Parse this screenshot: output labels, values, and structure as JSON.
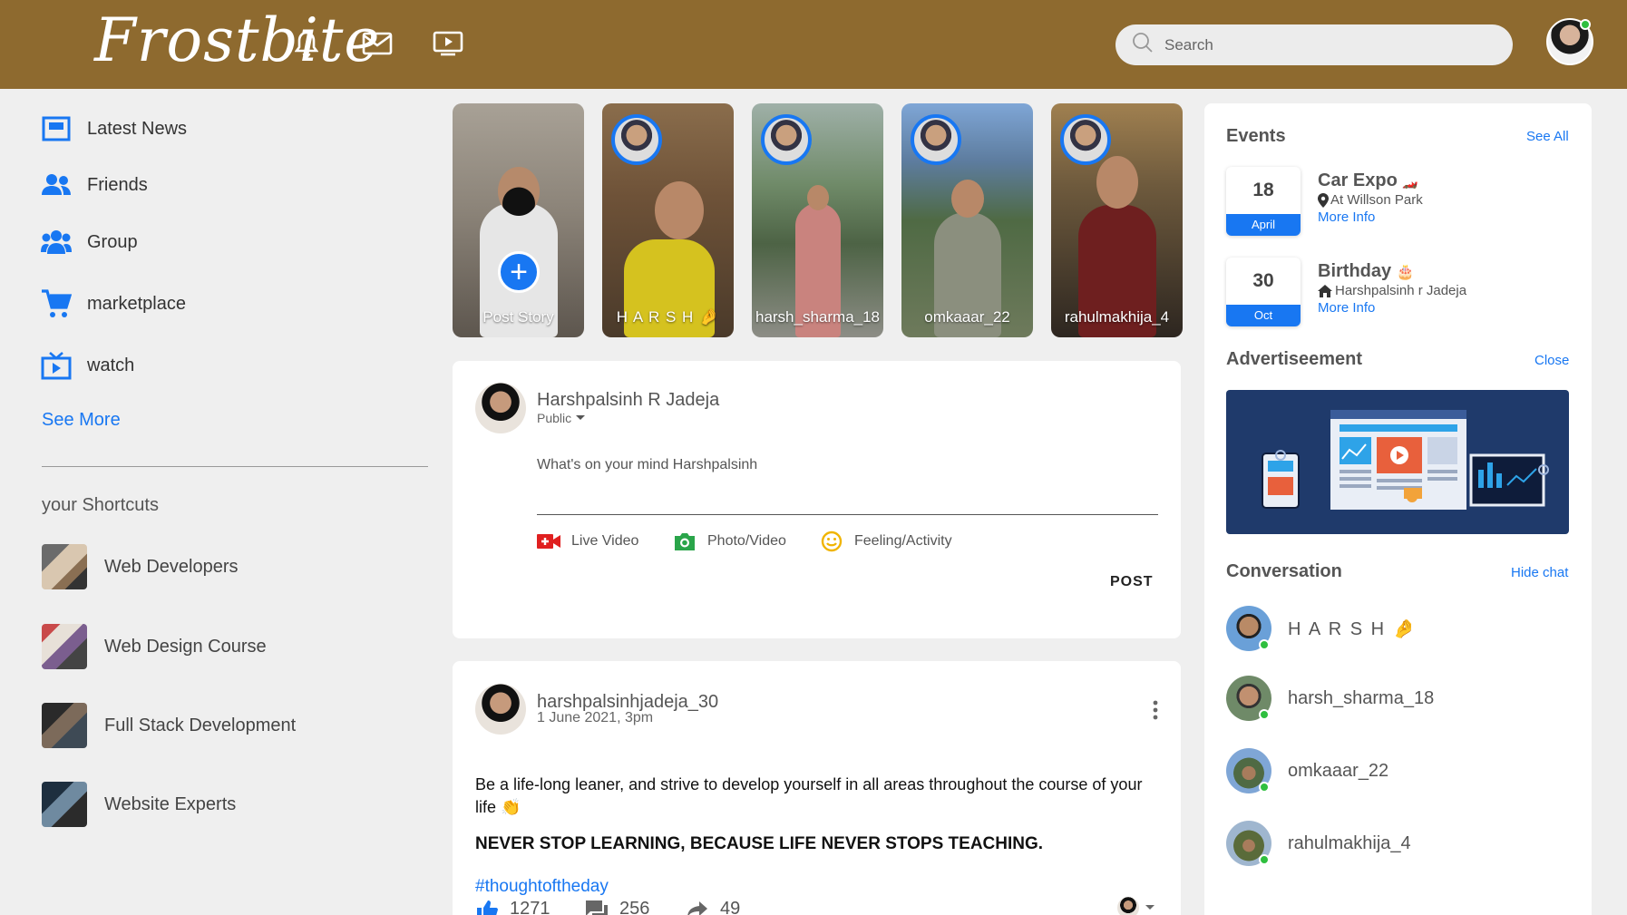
{
  "header": {
    "logo": "Frostbite",
    "search_placeholder": "Search",
    "icons": [
      "bell-icon",
      "mail-icon",
      "video-icon"
    ]
  },
  "sidebar": {
    "items": [
      {
        "label": "Latest News",
        "icon": "news-icon"
      },
      {
        "label": "Friends",
        "icon": "friends-icon"
      },
      {
        "label": "Group",
        "icon": "group-icon"
      },
      {
        "label": "marketplace",
        "icon": "cart-icon"
      },
      {
        "label": "watch",
        "icon": "tv-icon"
      }
    ],
    "see_more": "See More",
    "shortcuts_title": "your Shortcuts",
    "shortcuts": [
      {
        "label": "Web Developers"
      },
      {
        "label": "Web Design Course"
      },
      {
        "label": "Full Stack Development"
      },
      {
        "label": "Website Experts"
      }
    ]
  },
  "stories": [
    {
      "name": "Post Story"
    },
    {
      "name": "H A R S H 🤌"
    },
    {
      "name": "harsh_sharma_18"
    },
    {
      "name": "omkaaar_22"
    },
    {
      "name": "rahulmakhija_4"
    }
  ],
  "composer": {
    "user_name": "Harshpalsinh R Jadeja",
    "privacy": "Public",
    "placeholder": "What's on your mind Harshpalsinh",
    "actions": [
      "Live Video",
      "Photo/Video",
      "Feeling/Activity"
    ],
    "post_button": "POST"
  },
  "post": {
    "user_name": "harshpalsinhjadeja_30",
    "timestamp": "1 June 2021, 3pm",
    "text": "Be a life-long leaner, and strive to develop yourself in all areas throughout the course of your life 👏",
    "quote": "NEVER STOP LEARNING, BECAUSE LIFE NEVER STOPS TEACHING.",
    "hashtag": "#thoughtoftheday",
    "likes": "1271",
    "comments": "256",
    "shares": "49"
  },
  "events": {
    "title": "Events",
    "see_all": "See All",
    "items": [
      {
        "day": "18",
        "month": "April",
        "title": "Car Expo",
        "emoji": "🏎️",
        "location": "At Willson Park",
        "more": "More Info"
      },
      {
        "day": "30",
        "month": "Oct",
        "title": "Birthday",
        "emoji": "🎂",
        "location": "Harshpalsinh r Jadeja",
        "more": "More Info"
      }
    ]
  },
  "advertisement": {
    "title": "Advertiseement",
    "close": "Close"
  },
  "conversation": {
    "title": "Conversation",
    "hide": "Hide chat",
    "contacts": [
      {
        "name": "H A R S H 🤌"
      },
      {
        "name": "harsh_sharma_18"
      },
      {
        "name": "omkaaar_22"
      },
      {
        "name": "rahulmakhija_4"
      }
    ]
  },
  "colors": {
    "header": "#8e6a2f",
    "accent": "#1877f2",
    "online": "#2fbf3f"
  }
}
